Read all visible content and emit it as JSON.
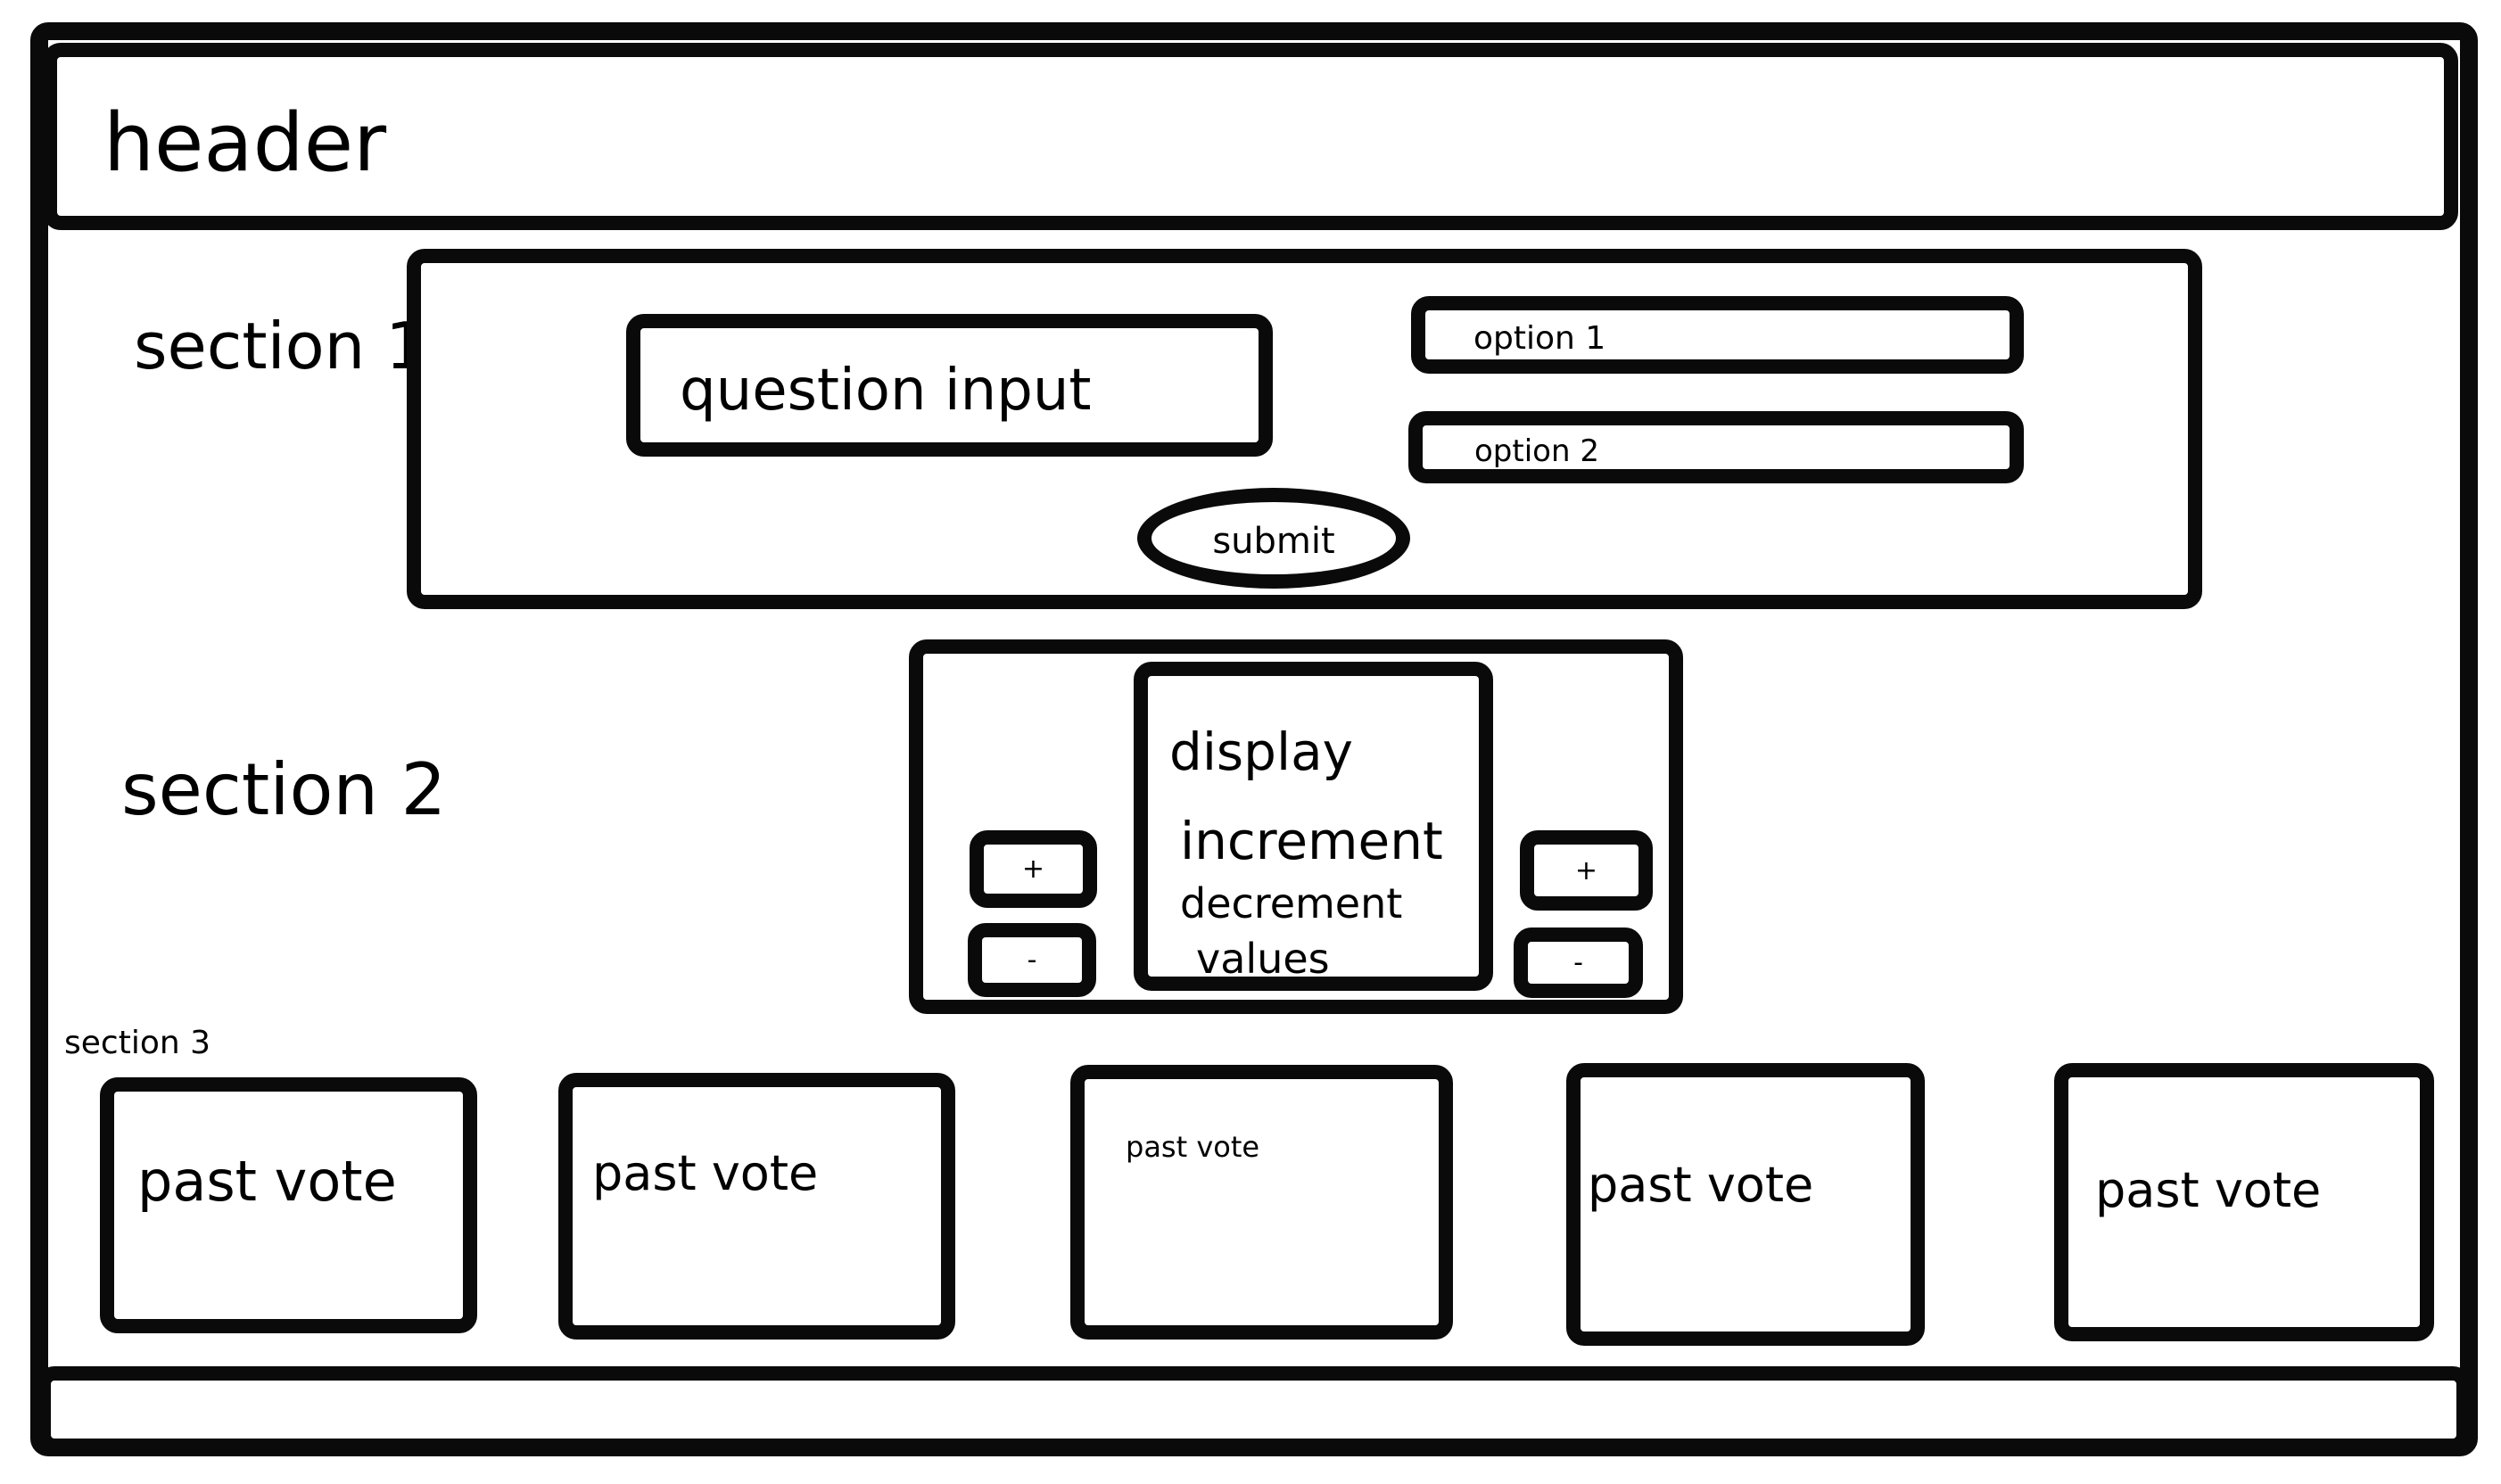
{
  "header": {
    "title": "header"
  },
  "section1": {
    "label": "section 1",
    "question_input": "question input",
    "option1": "option 1",
    "option2": "option 2",
    "submit": "submit"
  },
  "section2": {
    "label": "section 2",
    "display": {
      "title": "display",
      "line1": "increment",
      "line2": "decrement",
      "line3": "values"
    },
    "left_plus": "+",
    "left_minus": "-",
    "right_plus": "+",
    "right_minus": "-"
  },
  "section3": {
    "label": "section 3",
    "past_votes": [
      "past vote",
      "past vote",
      "past vote",
      "past vote",
      "past vote"
    ]
  }
}
